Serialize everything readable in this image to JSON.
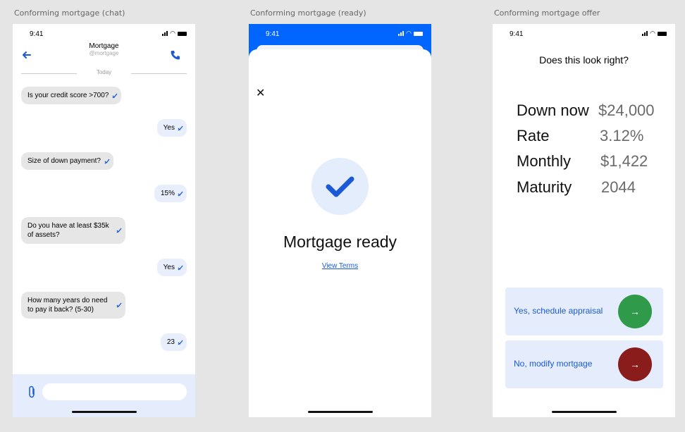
{
  "frames": {
    "chat": "Conforming mortgage (chat)",
    "ready": "Conforming mortgage (ready)",
    "offer": "Conforming mortgage offer"
  },
  "status_time": "9:41",
  "chat": {
    "title": "Mortgage",
    "handle": "@mortgage",
    "date_divider": "Today",
    "messages": [
      {
        "dir": "in",
        "text": "Is your credit score >700?"
      },
      {
        "dir": "out",
        "text": "Yes"
      },
      {
        "dir": "in",
        "text": "Size of down payment?"
      },
      {
        "dir": "out",
        "text": "15%"
      },
      {
        "dir": "in",
        "text": "Do you have at least $35k of assets?"
      },
      {
        "dir": "out",
        "text": "Yes"
      },
      {
        "dir": "in",
        "text": "How many years do need to pay it back? (5-30)"
      },
      {
        "dir": "out",
        "text": "23"
      }
    ],
    "input_placeholder": ""
  },
  "ready": {
    "title": "Mortgage ready",
    "link": "View Terms"
  },
  "offer": {
    "question": "Does this look right?",
    "rows": [
      {
        "label": "Down now",
        "value": "$24,000"
      },
      {
        "label": "Rate",
        "value": "3.12%"
      },
      {
        "label": "Monthly",
        "value": "$1,422"
      },
      {
        "label": "Maturity",
        "value": "2044"
      }
    ],
    "accept_label": "Yes, schedule appraisal",
    "modify_label": "No, modify mortgage"
  },
  "colors": {
    "accent": "#0066ff",
    "accept": "#2e9a4a",
    "modify": "#8b1c1c",
    "panel": "#e5edfd"
  },
  "icons": [
    "back-arrow-icon",
    "phone-icon",
    "read-check-icon",
    "paperclip-icon",
    "close-icon",
    "checkmark-icon",
    "arrow-right-icon"
  ]
}
